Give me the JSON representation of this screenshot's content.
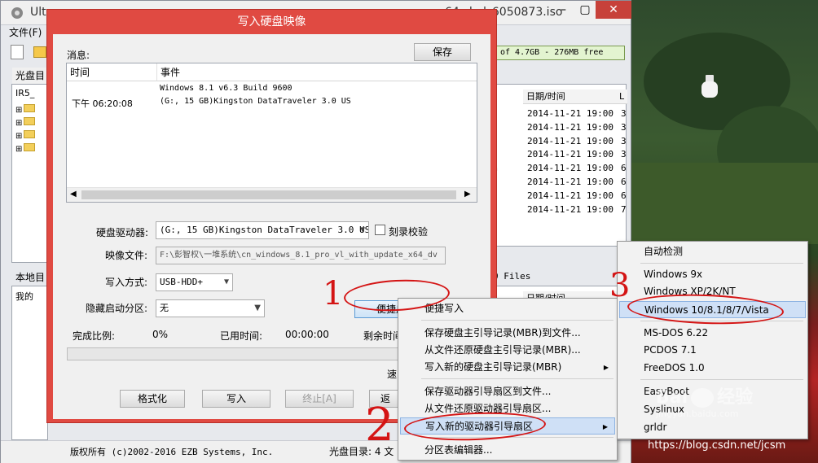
{
  "main_window": {
    "title": "UltraISO - F:\\彭智权\\一堆系统\\cn_windows_8.1_pro_vl_with_update_x64_dvd_6050873.iso",
    "title_visible_left": "Ult",
    "title_visible_right": "64_dvd_6050873.iso",
    "menu_file": "文件(F)",
    "disc_label": "光盘目",
    "capacity": "of 4.7GB - 276MB free",
    "iso_root": "IR5_",
    "local_label": "本地目",
    "local_root": "我的",
    "files_count": "0 Files",
    "copyright": "版权所有 (c)2002-2016 EZB Systems, Inc.",
    "disc_dir": "光盘目录: 4 文",
    "date_header": "日期/时间",
    "col_l": "L",
    "dates": [
      "2014-11-21 19:00",
      "2014-11-21 19:00",
      "2014-11-21 19:00",
      "2014-11-21 19:00",
      "2014-11-21 19:00",
      "2014-11-21 19:00",
      "2014-11-21 19:00",
      "2014-11-21 19:00"
    ],
    "lcol": [
      "3",
      "3",
      "3",
      "3",
      "6",
      "6",
      "6",
      "7"
    ],
    "partial_n": "n",
    "date_header2": "日期/时间"
  },
  "dialog": {
    "title": "写入硬盘映像",
    "messages_label": "消息:",
    "save": "保存",
    "col_time": "时间",
    "col_event": "事件",
    "log_line1": "Windows 8.1 v6.3 Build 9600",
    "log_time": "下午 06:20:08",
    "log_line2": "(G:, 15 GB)Kingston DataTraveler 3.0 US",
    "drive_label": "硬盘驱动器:",
    "drive_value": "(G:, 15 GB)Kingston DataTraveler 3.0 US",
    "verify_label": "刻录校验",
    "image_label": "映像文件:",
    "image_value": "F:\\彭智权\\一堆系统\\cn_windows_8.1_pro_vl_with_update_x64_dv",
    "method_label": "写入方式:",
    "method_value": "USB-HDD+",
    "hidden_label": "隐藏启动分区:",
    "hidden_value": "无",
    "quick_start": "便捷启动",
    "progress_label": "完成比例:",
    "progress_value": "0%",
    "elapsed_label": "已用时间:",
    "elapsed_value": "00:00:00",
    "remaining_label": "剩余时间",
    "speed_label": "速",
    "format": "格式化",
    "write": "写入",
    "terminate": "终止[A]",
    "back_partial": "返"
  },
  "context_menu": {
    "items": [
      "便捷写入",
      "保存硬盘主引导记录(MBR)到文件...",
      "从文件还原硬盘主引导记录(MBR)...",
      "写入新的硬盘主引导记录(MBR)",
      "保存驱动器引导扇区到文件...",
      "从文件还原驱动器引导扇区...",
      "写入新的驱动器引导扇区",
      "分区表编辑器..."
    ]
  },
  "sub_menu": {
    "items": [
      "自动检测",
      "Windows 9x",
      "Windows XP/2K/NT",
      "Windows 10/8.1/8/7/Vista",
      "MS-DOS 6.22",
      "PCDOS 7.1",
      "FreeDOS 1.0",
      "EasyBoot",
      "Syslinux",
      "grldr"
    ]
  },
  "annotations": {
    "n1": "1",
    "n2": "2",
    "n3": "3"
  },
  "watermark": {
    "brand": "Bai",
    "brand_cn": "经验",
    "site": "jingyan.baidu.com",
    "blog": "https://blog.csdn.net/jcsm"
  },
  "colors": {
    "dialog_frame": "#e04a42",
    "annotation": "#d41414",
    "highlight": "#cfe0f6"
  }
}
